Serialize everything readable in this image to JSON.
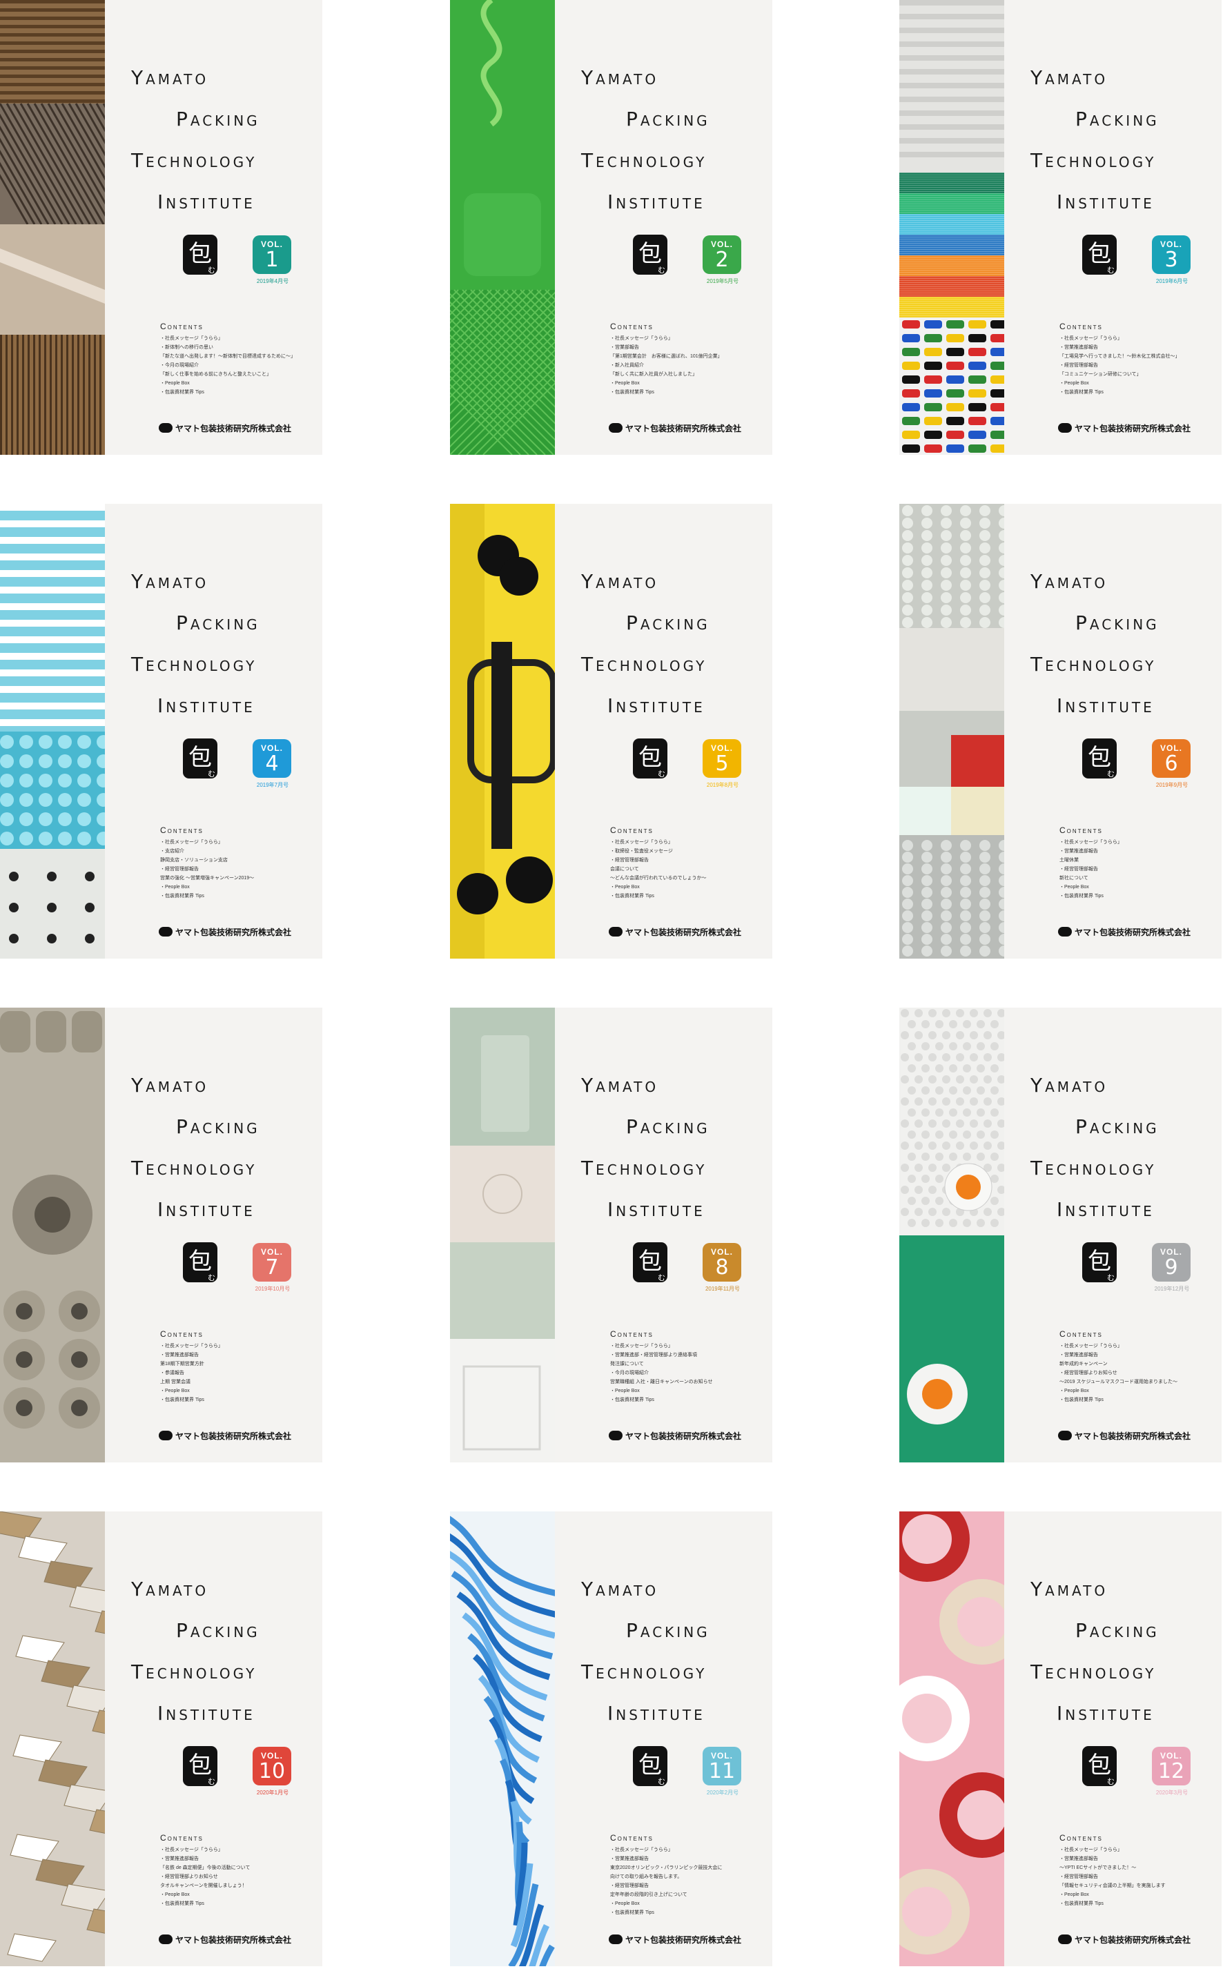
{
  "covers": [
    {
      "title_lines": [
        "Yamato",
        "Packing",
        "Technology",
        "Institute"
      ],
      "logo_text": "包",
      "logo_sub": "む",
      "vol_label": "VOL.",
      "vol_number": "1",
      "issue_date": "2019年4月号",
      "vol_color": "#1a9b8c",
      "contents_heading": "Contents",
      "contents": [
        "・社長メッセージ「うらら」",
        "・新体制への移行の思い",
        "「新たな道へ出発します！～新体制で目標達成するために～」",
        "・今月の現場紹介",
        "「新しく仕事を始める前にきちんと整えたいこと」",
        "・People Box",
        "・包装資材業界 Tips"
      ],
      "company": "ヤマト包装技術研究所株式会社",
      "photo_theme": "cardboard"
    },
    {
      "title_lines": [
        "Yamato",
        "Packing",
        "Technology",
        "Institute"
      ],
      "logo_text": "包",
      "logo_sub": "む",
      "vol_label": "VOL.",
      "vol_number": "2",
      "issue_date": "2019年5月号",
      "vol_color": "#3aa84a",
      "contents_heading": "Contents",
      "contents": [
        "・社長メッセージ「うらら」",
        "・営業部報告",
        "「第1期営業会計　お客様に選ばれ、101億円企業」",
        "・新入社員紹介",
        "「新しく共に新入社員が入社しました」",
        "・People Box",
        "・包装資材業界 Tips"
      ],
      "company": "ヤマト包装技術研究所株式会社",
      "photo_theme": "green-plastic"
    },
    {
      "title_lines": [
        "Yamato",
        "Packing",
        "Technology",
        "Institute"
      ],
      "logo_text": "包",
      "logo_sub": "む",
      "vol_label": "VOL.",
      "vol_number": "3",
      "issue_date": "2019年6月号",
      "vol_color": "#19a3b8",
      "contents_heading": "Contents",
      "contents": [
        "・社長メッセージ「うらら」",
        "・営業推進部報告",
        "「工場見学へ行ってきました！～鈴木化工株式会社～」",
        "・経営管理部報告",
        "「コミュニケーション研修について」",
        "・People Box",
        "・包装資材業界 Tips"
      ],
      "company": "ヤマト包装技術研究所株式会社",
      "photo_theme": "colored-cardboard"
    },
    {
      "title_lines": [
        "Yamato",
        "Packing",
        "Technology",
        "Institute"
      ],
      "logo_text": "包",
      "logo_sub": "む",
      "vol_label": "VOL.",
      "vol_number": "4",
      "issue_date": "2019年7月号",
      "vol_color": "#1f9ad8",
      "contents_heading": "Contents",
      "contents": [
        "・社長メッセージ「うらら」",
        "・支店紹介",
        "静岡支店・ソリューション支店",
        "・経営管理部報告",
        "営業の強化 ～営業増強キャンペーン2019～",
        "・People Box",
        "・包装資材業界 Tips"
      ],
      "company": "ヤマト包装技術研究所株式会社",
      "photo_theme": "cyan-foam"
    },
    {
      "title_lines": [
        "Yamato",
        "Packing",
        "Technology",
        "Institute"
      ],
      "logo_text": "包",
      "logo_sub": "む",
      "vol_label": "VOL.",
      "vol_number": "5",
      "issue_date": "2019年8月号",
      "vol_color": "#f2b500",
      "contents_heading": "Contents",
      "contents": [
        "・社長メッセージ「うらら」",
        "・取締役・監査役メッセージ",
        "・経営管理部報告",
        "会議について",
        "～どんな会議が行われているのでしょうか～",
        "・People Box",
        "・包装資材業界 Tips"
      ],
      "company": "ヤマト包装技術研究所株式会社",
      "photo_theme": "yellow-pump"
    },
    {
      "title_lines": [
        "Yamato",
        "Packing",
        "Technology",
        "Institute"
      ],
      "logo_text": "包",
      "logo_sub": "む",
      "vol_label": "VOL.",
      "vol_number": "6",
      "issue_date": "2019年9月号",
      "vol_color": "#e87722",
      "contents_heading": "Contents",
      "contents": [
        "・社長メッセージ「うらら」",
        "・営業推進部報告",
        "土曜休業",
        "・経営管理部報告",
        "新社について",
        "・People Box",
        "・包装資材業界 Tips"
      ],
      "company": "ヤマト包装技術研究所株式会社",
      "photo_theme": "bubble-wrap"
    },
    {
      "title_lines": [
        "Yamato",
        "Packing",
        "Technology",
        "Institute"
      ],
      "logo_text": "包",
      "logo_sub": "む",
      "vol_label": "VOL.",
      "vol_number": "7",
      "issue_date": "2019年10月号",
      "vol_color": "#e5746a",
      "contents_heading": "Contents",
      "contents": [
        "・社長メッセージ「うらら」",
        "・営業推進部報告",
        "第18期下期営業方針",
        "・参議報告",
        "上期 営業会議",
        "・People Box",
        "・包装資材業界 Tips"
      ],
      "company": "ヤマト包装技術研究所株式会社",
      "photo_theme": "pulp-mold"
    },
    {
      "title_lines": [
        "Yamato",
        "Packing",
        "Technology",
        "Institute"
      ],
      "logo_text": "包",
      "logo_sub": "む",
      "vol_label": "VOL.",
      "vol_number": "8",
      "issue_date": "2019年11月号",
      "vol_color": "#c98a2c",
      "contents_heading": "Contents",
      "contents": [
        "・社長メッセージ「うらら」",
        "・営業推進部・経営管理部より連絡事項",
        "発注課について",
        "・今月の現場紹介",
        "営業職種組 入社・離日キャンペーンのお知らせ",
        "・People Box",
        "・包装資材業界 Tips"
      ],
      "company": "ヤマト包装技術研究所株式会社",
      "photo_theme": "sage-cardboard"
    },
    {
      "title_lines": [
        "Yamato",
        "Packing",
        "Technology",
        "Institute"
      ],
      "logo_text": "包",
      "logo_sub": "む",
      "vol_label": "VOL.",
      "vol_number": "9",
      "issue_date": "2019年12月号",
      "vol_color": "#a7a9ab",
      "contents_heading": "Contents",
      "contents": [
        "・社長メッセージ「うらら」",
        "・営業推進部報告",
        "新年成約キャンペーン",
        "・経営管理部よりお知らせ",
        "～2019 スケジュールマスクコード運用始まりました～",
        "・People Box",
        "・包装資材業界 Tips"
      ],
      "company": "ヤマト包装技術研究所株式会社",
      "photo_theme": "foam-beads"
    },
    {
      "title_lines": [
        "Yamato",
        "Packing",
        "Technology",
        "Institute"
      ],
      "logo_text": "包",
      "logo_sub": "む",
      "vol_label": "VOL.",
      "vol_number": "10",
      "issue_date": "2020年1月号",
      "vol_color": "#e0463a",
      "contents_heading": "Contents",
      "contents": [
        "・社長メッセージ「うらら」",
        "・営業推進部報告",
        "「名鉄 de 森定期便」今後の活動について",
        "・経営管理部よりお知らせ",
        "タオルキャンペーンを開催しましょう！",
        "・People Box",
        "・包装資材業界 Tips"
      ],
      "company": "ヤマト包装技術研究所株式会社",
      "photo_theme": "cardboard-scraps"
    },
    {
      "title_lines": [
        "Yamato",
        "Packing",
        "Technology",
        "Institute"
      ],
      "logo_text": "包",
      "logo_sub": "む",
      "vol_label": "VOL.",
      "vol_number": "11",
      "issue_date": "2020年2月号",
      "vol_color": "#6ec1d6",
      "contents_heading": "Contents",
      "contents": [
        "・社長メッセージ「うらら」",
        "・営業推進部報告",
        "東京2020オリンピック・パラリンピック競技大会に",
        "向けての取り組みを報告します。",
        "・経営管理部報告",
        "定年年齢の段階的引き上げについて",
        "・People Box",
        "・包装資材業界 Tips"
      ],
      "company": "ヤマト包装技術研究所株式会社",
      "photo_theme": "blue-ribbon"
    },
    {
      "title_lines": [
        "Yamato",
        "Packing",
        "Technology",
        "Institute"
      ],
      "logo_text": "包",
      "logo_sub": "む",
      "vol_label": "VOL.",
      "vol_number": "12",
      "issue_date": "2020年3月号",
      "vol_color": "#eaa3b8",
      "contents_heading": "Contents",
      "contents": [
        "・社長メッセージ「うらら」",
        "・営業推進部報告",
        "～YPTI ECサイトができました！～",
        "・経営管理部報告",
        "「情報セキュリティ会議の上半期」を実施します",
        "・People Box",
        "・包装資材業界 Tips"
      ],
      "company": "ヤマト包装技術研究所株式会社",
      "photo_theme": "tape-rolls"
    }
  ]
}
